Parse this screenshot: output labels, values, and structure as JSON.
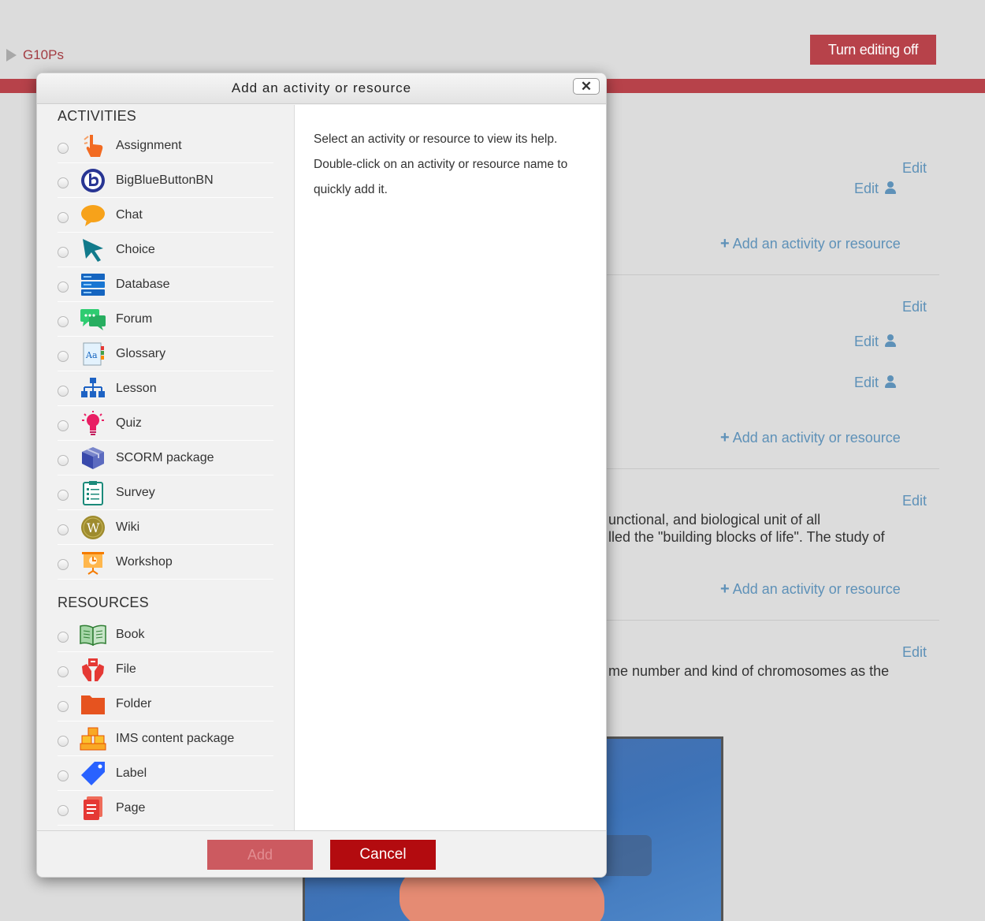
{
  "page": {
    "breadcrumb": "G10Ps",
    "edit_toggle": "Turn editing off",
    "edit_label": "Edit",
    "add_activity_label": "Add an activity or resource",
    "text_snippets": [
      "unctional, and biological unit of all",
      "lled the \"building blocks of life\". The study of",
      "me number and kind of chromosomes as the"
    ]
  },
  "modal": {
    "title": "Add an activity or resource",
    "close_label": "✕",
    "activities_heading": "ACTIVITIES",
    "resources_heading": "RESOURCES",
    "activities": [
      {
        "label": "Assignment",
        "icon": "assignment-icon"
      },
      {
        "label": "BigBlueButtonBN",
        "icon": "bigbluebutton-icon"
      },
      {
        "label": "Chat",
        "icon": "chat-icon"
      },
      {
        "label": "Choice",
        "icon": "choice-icon"
      },
      {
        "label": "Database",
        "icon": "database-icon"
      },
      {
        "label": "Forum",
        "icon": "forum-icon"
      },
      {
        "label": "Glossary",
        "icon": "glossary-icon"
      },
      {
        "label": "Lesson",
        "icon": "lesson-icon"
      },
      {
        "label": "Quiz",
        "icon": "quiz-icon"
      },
      {
        "label": "SCORM package",
        "icon": "scorm-icon"
      },
      {
        "label": "Survey",
        "icon": "survey-icon"
      },
      {
        "label": "Wiki",
        "icon": "wiki-icon"
      },
      {
        "label": "Workshop",
        "icon": "workshop-icon"
      }
    ],
    "resources": [
      {
        "label": "Book",
        "icon": "book-icon"
      },
      {
        "label": "File",
        "icon": "file-icon"
      },
      {
        "label": "Folder",
        "icon": "folder-icon"
      },
      {
        "label": "IMS content package",
        "icon": "ims-package-icon"
      },
      {
        "label": "Label",
        "icon": "label-icon"
      },
      {
        "label": "Page",
        "icon": "page-icon"
      }
    ],
    "help_text": "Select an activity or resource to view its help. Double-click on an activity or resource name to quickly add it.",
    "add_button": "Add",
    "cancel_button": "Cancel"
  },
  "colors": {
    "brand_red": "#b7424a",
    "link_blue": "#5e91b8",
    "cancel_red": "#b30b0f"
  }
}
